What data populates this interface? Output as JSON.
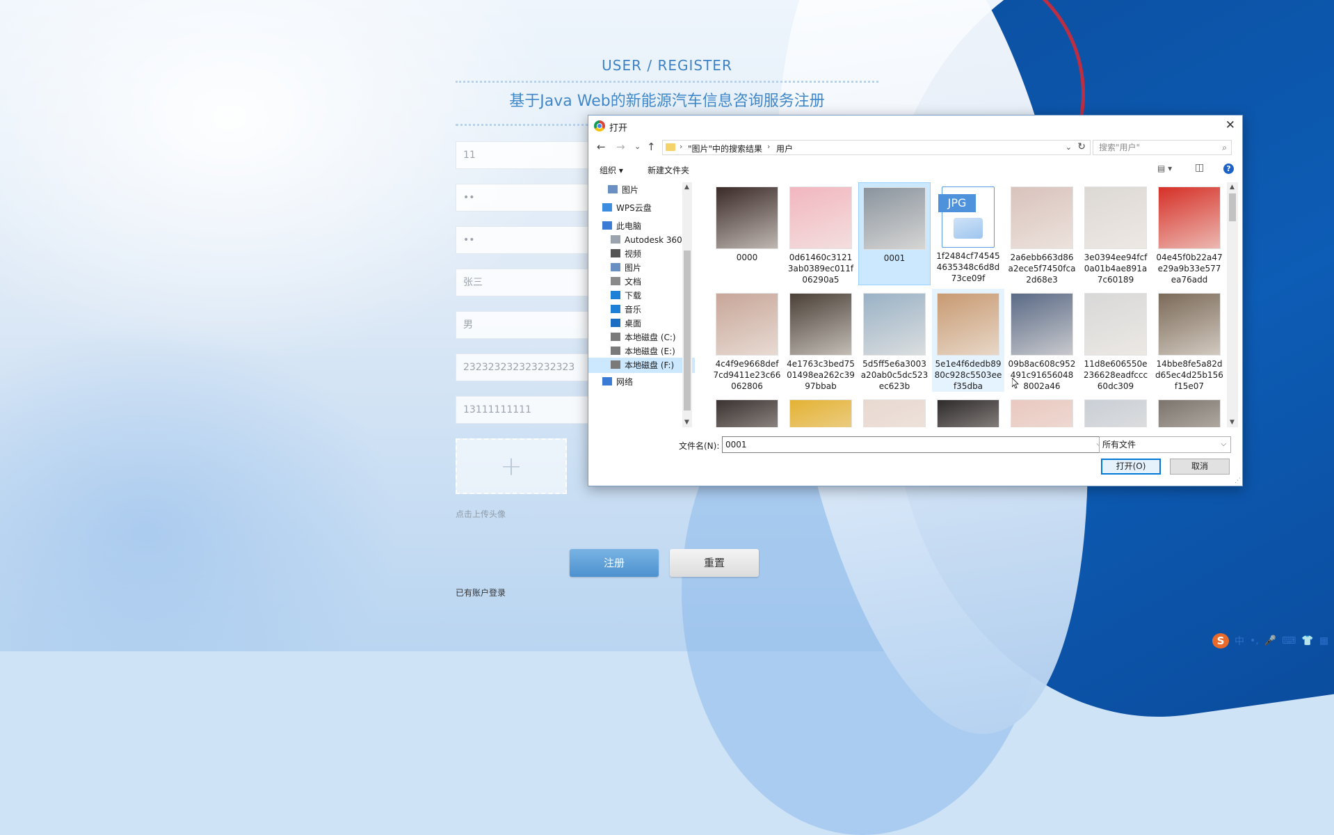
{
  "form": {
    "subtitle": "USER / REGISTER",
    "title": "基于Java Web的新能源汽车信息咨询服务注册",
    "fields": {
      "account": "11",
      "password": "••",
      "confirm_password": "••",
      "name": "张三",
      "gender": "男",
      "id_number": "232323232323232323",
      "phone": "13111111111"
    },
    "upload_plus": "+",
    "upload_hint": "点击上传头像",
    "register_label": "注册",
    "reset_label": "重置",
    "login_link": "已有账户登录"
  },
  "dialog": {
    "title": "打开",
    "close_glyph": "✕",
    "nav": {
      "back": "←",
      "forward": "→",
      "recent": "⌄",
      "up": "↑"
    },
    "address": {
      "crumbs": [
        "\"图片\"中的搜索结果",
        "用户"
      ],
      "separator": "›",
      "dropdown": "⌄",
      "refresh": "↻"
    },
    "search_placeholder": "搜索\"用户\"",
    "search_glyph": "⌕",
    "toolbar": {
      "organize": "组织 ▾",
      "new_folder": "新建文件夹",
      "view_glyph": "▤ ▾",
      "pane_glyph": "◫",
      "help": "?"
    },
    "nav_pane": [
      {
        "label": "图片",
        "icon": "pictures-icon",
        "pinned": "📌"
      },
      {
        "label": "WPS云盘",
        "icon": "cloud-icon"
      },
      {
        "label": "此电脑",
        "icon": "computer-icon"
      },
      {
        "label": "Autodesk 360",
        "icon": "autodesk-icon"
      },
      {
        "label": "视频",
        "icon": "video-icon"
      },
      {
        "label": "图片",
        "icon": "pictures-icon"
      },
      {
        "label": "文档",
        "icon": "documents-icon"
      },
      {
        "label": "下载",
        "icon": "download-icon"
      },
      {
        "label": "音乐",
        "icon": "music-icon"
      },
      {
        "label": "桌面",
        "icon": "desktop-icon"
      },
      {
        "label": "本地磁盘 (C:)",
        "icon": "drive-c-icon"
      },
      {
        "label": "本地磁盘 (E:)",
        "icon": "drive-e-icon"
      },
      {
        "label": "本地磁盘 (F:)",
        "icon": "drive-f-icon"
      },
      {
        "label": "网络",
        "icon": "network-icon"
      }
    ],
    "scroll": {
      "up": "▲",
      "down": "▼"
    },
    "files": [
      {
        "name": "0000",
        "tone": "#3a2a28"
      },
      {
        "name": "0d61460c31213ab0389ec011f06290a5",
        "tone": "#f2b6c0"
      },
      {
        "name": "0001",
        "tone": "#8a949e"
      },
      {
        "name": "1f2484cf745454635348c6d8d73ce09f",
        "icon": "jpg",
        "label": "JPG"
      },
      {
        "name": "2a6ebb663d86a2ece5f7450fca2d68e3",
        "tone": "#d9c2bc"
      },
      {
        "name": "3e0394ee94fcf0a01b4ae891a7c60189",
        "tone": "#dcd8d4"
      },
      {
        "name": "04e45f0b22a47e29a9b33e577ea76add",
        "tone": "#d63027"
      },
      {
        "name": "4c4f9e9668def7cd9411e23c66062806",
        "tone": "#c8a699"
      },
      {
        "name": "4e1763c3bed7501498ea262c3997bbab",
        "tone": "#4a4038"
      },
      {
        "name": "5d5ff5e6a3003a20ab0c5dc523ec623b",
        "tone": "#9ab2c6"
      },
      {
        "name": "5e1e4f6dedb8980c928c5503eef35dba",
        "tone": "#c89a72"
      },
      {
        "name": "09b8ac608c952491c916560488002a46",
        "tone": "#5a6a86"
      },
      {
        "name": "11d8e606550e236628eadfccc60dc309",
        "tone": "#d8d8d8"
      },
      {
        "name": "14bbe8fe5a82dd65ec4d25b156f15e07",
        "tone": "#7b6a58"
      },
      {
        "name": "",
        "tone": "#3a3230"
      },
      {
        "name": "",
        "tone": "#e4b233"
      },
      {
        "name": "",
        "tone": "#e8d8d0"
      },
      {
        "name": "",
        "tone": "#2e2a2a"
      },
      {
        "name": "",
        "tone": "#e9c8c0"
      },
      {
        "name": "",
        "tone": "#c9cfd6"
      },
      {
        "name": "",
        "tone": "#7b746c"
      }
    ],
    "filename_label": "文件名(N):",
    "filename_value": "0001",
    "filetype": "所有文件",
    "open_label": "打开(O)",
    "cancel_label": "取消",
    "grip_glyph": "⋰"
  },
  "ime": {
    "logo": "S",
    "lang": "中",
    "items": [
      "•,",
      "🎤",
      "⌨",
      "👕",
      "▦"
    ]
  }
}
